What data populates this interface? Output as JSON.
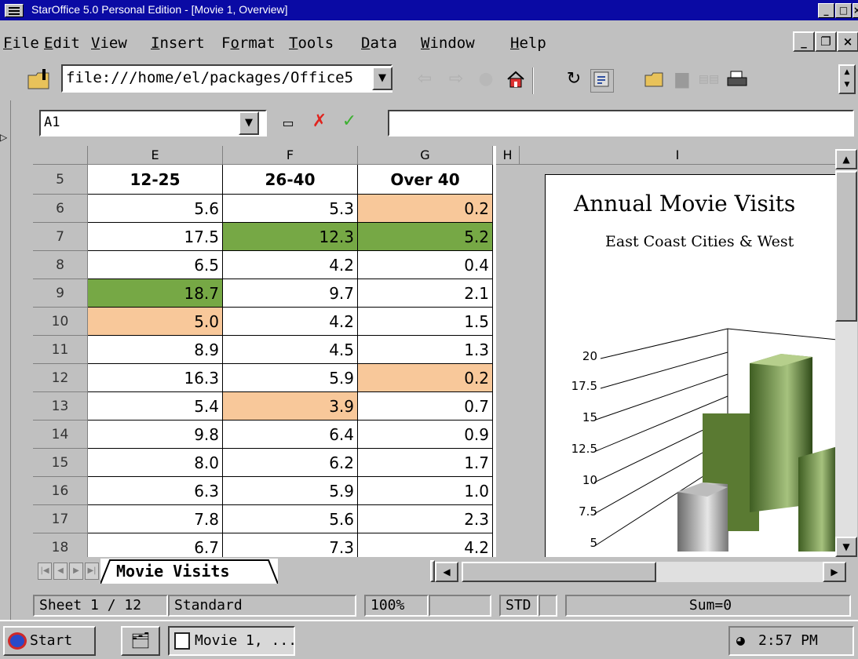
{
  "window": {
    "title": "StarOffice 5.0 Personal Edition - [Movie 1, Overview]"
  },
  "menu": [
    {
      "label": "File",
      "u": "F"
    },
    {
      "label": "Edit",
      "u": "E"
    },
    {
      "label": "View",
      "u": "V"
    },
    {
      "label": "Insert",
      "u": "I"
    },
    {
      "label": "Format",
      "u": "o"
    },
    {
      "label": "Tools",
      "u": "T"
    },
    {
      "label": "Data",
      "u": "D"
    },
    {
      "label": "Window",
      "u": "W"
    },
    {
      "label": "Help",
      "u": "H"
    }
  ],
  "url": {
    "value": "file:///home/el/packages/Office5"
  },
  "namebox": {
    "value": "A1"
  },
  "formula": {
    "value": ""
  },
  "grid": {
    "columns": [
      "E",
      "F",
      "G",
      "H",
      "I"
    ],
    "header_row": {
      "num": "5",
      "cells": [
        "12-25",
        "26-40",
        "Over 40"
      ]
    },
    "rows": [
      {
        "num": "6",
        "cells": [
          "5.6",
          "5.3",
          "0.2"
        ],
        "hl": [
          "",
          "",
          "orange"
        ]
      },
      {
        "num": "7",
        "cells": [
          "17.5",
          "12.3",
          "5.2"
        ],
        "hl": [
          "",
          "green",
          "green"
        ]
      },
      {
        "num": "8",
        "cells": [
          "6.5",
          "4.2",
          "0.4"
        ],
        "hl": [
          "",
          "",
          ""
        ]
      },
      {
        "num": "9",
        "cells": [
          "18.7",
          "9.7",
          "2.1"
        ],
        "hl": [
          "green",
          "",
          ""
        ]
      },
      {
        "num": "10",
        "cells": [
          "5.0",
          "4.2",
          "1.5"
        ],
        "hl": [
          "orange",
          "",
          ""
        ]
      },
      {
        "num": "11",
        "cells": [
          "8.9",
          "4.5",
          "1.3"
        ],
        "hl": [
          "",
          "",
          ""
        ]
      },
      {
        "num": "12",
        "cells": [
          "16.3",
          "5.9",
          "0.2"
        ],
        "hl": [
          "",
          "",
          "orange"
        ]
      },
      {
        "num": "13",
        "cells": [
          "5.4",
          "3.9",
          "0.7"
        ],
        "hl": [
          "",
          "orange",
          ""
        ]
      },
      {
        "num": "14",
        "cells": [
          "9.8",
          "6.4",
          "0.9"
        ],
        "hl": [
          "",
          "",
          ""
        ]
      },
      {
        "num": "15",
        "cells": [
          "8.0",
          "6.2",
          "1.7"
        ],
        "hl": [
          "",
          "",
          ""
        ]
      },
      {
        "num": "16",
        "cells": [
          "6.3",
          "5.9",
          "1.0"
        ],
        "hl": [
          "",
          "",
          ""
        ]
      },
      {
        "num": "17",
        "cells": [
          "7.8",
          "5.6",
          "2.3"
        ],
        "hl": [
          "",
          "",
          ""
        ]
      },
      {
        "num": "18",
        "cells": [
          "6.7",
          "7.3",
          "4.2"
        ],
        "hl": [
          "",
          "",
          ""
        ]
      }
    ],
    "colors": {
      "green": "#76a845",
      "orange": "#f8c89a"
    }
  },
  "chart": {
    "title": "Annual Movie Visits",
    "subtitle": "East Coast Cities & West",
    "y_ticks": [
      "20",
      "17.5",
      "15",
      "12.5",
      "10",
      "7.5",
      "5"
    ]
  },
  "tabs": {
    "active": "Movie Visits"
  },
  "status": {
    "sheet": "Sheet 1 / 12",
    "style": "Standard",
    "zoom": "100%",
    "mode": "STD",
    "sum": "Sum=0"
  },
  "taskbar": {
    "start": "Start",
    "task": "Movie 1, ...",
    "clock": "2:57 PM"
  }
}
